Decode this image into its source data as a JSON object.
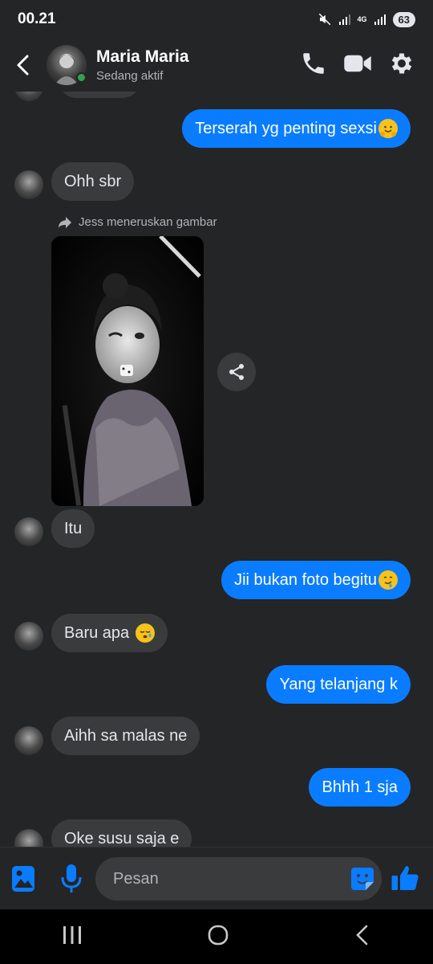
{
  "status_bar": {
    "time": "00.21",
    "network": "4G",
    "battery": "63"
  },
  "header": {
    "name": "Maria Maria",
    "status": "Sedang aktif"
  },
  "forward_note": "Jess meneruskan gambar",
  "messages": [
    {
      "id": "m1",
      "dir": "out",
      "text": "Terserah yg penting sexsi",
      "emoji": "hugging-face"
    },
    {
      "id": "m2",
      "dir": "in",
      "text": "Ohh sbr"
    },
    {
      "id": "m3",
      "dir": "in",
      "text": "Itu"
    },
    {
      "id": "m4",
      "dir": "out",
      "text": "Jii bukan foto begitu",
      "emoji": "drooling-face"
    },
    {
      "id": "m5",
      "dir": "in",
      "text": "Baru apa",
      "emoji": "sleepy-face"
    },
    {
      "id": "m6",
      "dir": "out",
      "text": "Yang telanjang k"
    },
    {
      "id": "m7",
      "dir": "in",
      "text": "Aihh sa malas ne"
    },
    {
      "id": "m8",
      "dir": "out",
      "text": "Bhhh 1 sja"
    },
    {
      "id": "m9",
      "dir": "in",
      "text": "Oke susu saja e"
    }
  ],
  "composer": {
    "placeholder": "Pesan"
  },
  "colors": {
    "accent": "#0a7cff",
    "background": "#242526",
    "incoming": "#3a3b3c",
    "online": "#31a24c"
  },
  "icons": [
    "back-arrow-icon",
    "phone-icon",
    "video-icon",
    "gear-icon",
    "forward-icon",
    "share-icon",
    "image-icon",
    "mic-icon",
    "sticker-icon",
    "thumbs-up-icon",
    "recents-icon",
    "home-icon",
    "nav-back-icon"
  ]
}
